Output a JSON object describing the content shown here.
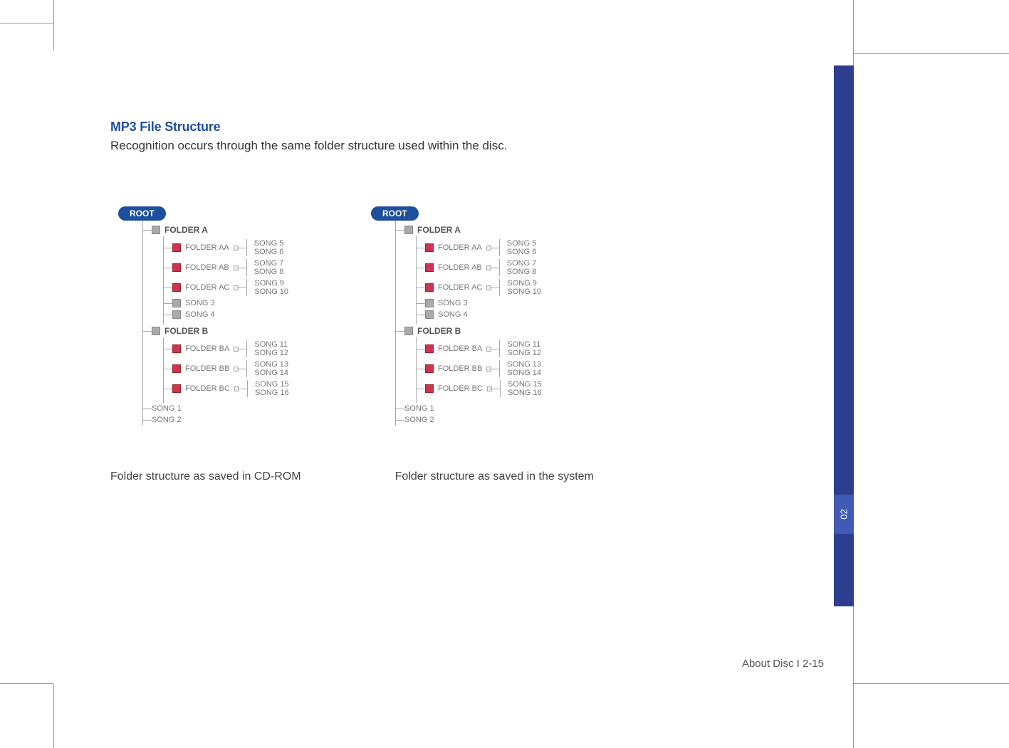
{
  "page": {
    "section_title": "MP3 File Structure",
    "section_desc": "Recognition occurs through the same folder structure used within the disc.",
    "footer": "About Disc I 2-15",
    "side_tab": "02"
  },
  "captions": {
    "left": "Folder structure as saved in CD-ROM",
    "right": "Folder structure as saved in the system"
  },
  "tree": {
    "root": "ROOT",
    "folder_a": "FOLDER A",
    "folder_aa": "FOLDER AA",
    "folder_ab": "FOLDER AB",
    "folder_ac": "FOLDER AC",
    "folder_b": "FOLDER B",
    "folder_ba": "FOLDER BA",
    "folder_bb": "FOLDER BB",
    "folder_bc": "FOLDER BC",
    "song1": "SONG 1",
    "song2": "SONG 2",
    "song3": "SONG 3",
    "song4": "SONG 4",
    "song5": "SONG 5",
    "song6": "SONG 6",
    "song7": "SONG 7",
    "song8": "SONG 8",
    "song9": "SONG 9",
    "song10": "SONG 10",
    "song11": "SONG 11",
    "song12": "SONG 12",
    "song13": "SONG 13",
    "song14": "SONG 14",
    "song15": "SONG 15",
    "song16": "SONG 16"
  }
}
